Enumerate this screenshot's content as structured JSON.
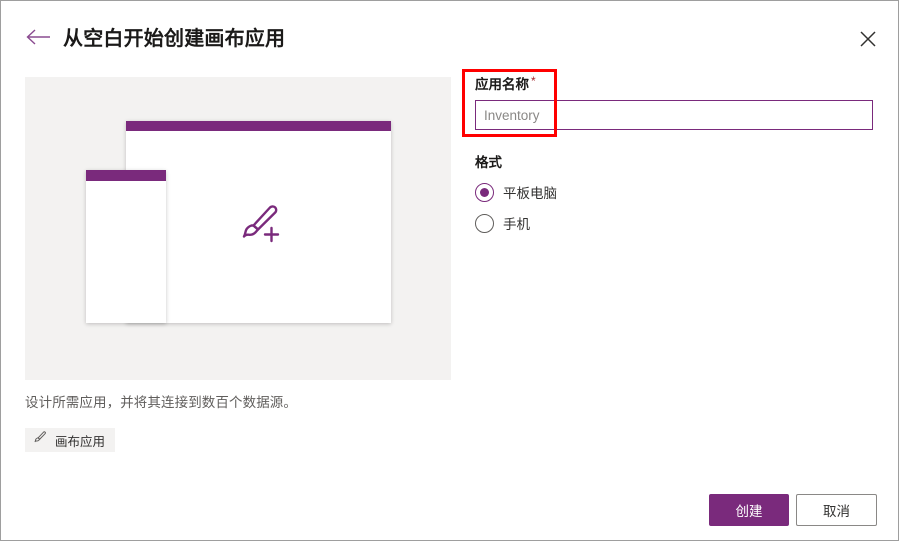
{
  "dialog": {
    "title": "从空白开始创建画布应用",
    "back_icon": "arrow-left-icon",
    "close_icon": "close-icon"
  },
  "preview": {
    "tablet_frame_label": "tablet-preview-frame",
    "phone_frame_label": "phone-preview-frame",
    "art_icon": "paintbrush-plus-icon"
  },
  "info": {
    "description": "设计所需应用，并将其连接到数百个数据源。",
    "tag_label": "画布应用",
    "tag_icon": "paintbrush-icon"
  },
  "form": {
    "app_name": {
      "label": "应用名称",
      "required_marker": "*",
      "value": "",
      "placeholder": "Inventory"
    },
    "format": {
      "label": "格式",
      "options": [
        {
          "label": "平板电脑",
          "selected": true
        },
        {
          "label": "手机",
          "selected": false
        }
      ]
    }
  },
  "footer": {
    "create_label": "创建",
    "cancel_label": "取消"
  },
  "colors": {
    "accent_purple": "#7a2a7c",
    "panel_gray": "#f3f2f1",
    "required_red": "#a4262c",
    "annotation_red": "#ff0000",
    "text_primary": "#1b1a19",
    "text_secondary": "#605e5c"
  }
}
